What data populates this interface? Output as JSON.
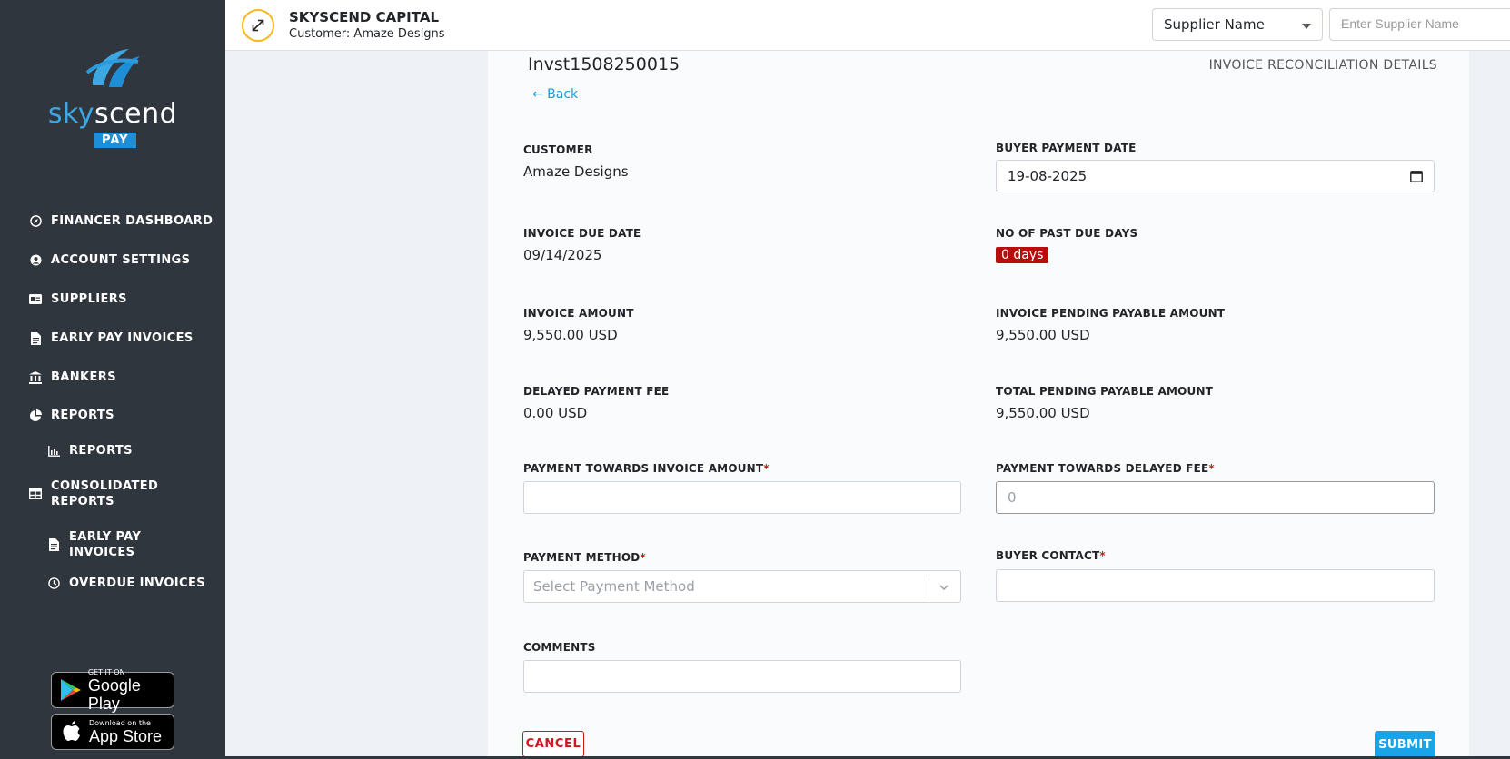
{
  "sidebar": {
    "logo": {
      "word_a": "sky",
      "word_b": "scend",
      "badge": "PAY"
    },
    "items": [
      {
        "label": "FINANCER DASHBOARD",
        "icon": "compass-icon"
      },
      {
        "label": "ACCOUNT SETTINGS",
        "icon": "user-circle-icon"
      },
      {
        "label": "SUPPLIERS",
        "icon": "id-card-icon"
      },
      {
        "label": "EARLY PAY INVOICES",
        "icon": "document-icon"
      },
      {
        "label": "BANKERS",
        "icon": "bank-icon"
      },
      {
        "label": "REPORTS",
        "icon": "pie-chart-icon"
      },
      {
        "label": "REPORTS",
        "icon": "bar-chart-icon"
      },
      {
        "label": "CONSOLIDATED REPORTS",
        "icon": "table-icon"
      },
      {
        "label": "EARLY PAY INVOICES",
        "icon": "document-icon"
      },
      {
        "label": "OVERDUE INVOICES",
        "icon": "clock-icon"
      }
    ],
    "stores": {
      "google_small": "GET IT ON",
      "google_big": "Google Play",
      "apple_small": "Download on the",
      "apple_big": "App Store"
    }
  },
  "header": {
    "company": "SKYSCEND CAPITAL",
    "customer_line": "Customer: Amaze Designs",
    "filter_select": "Supplier Name",
    "filter_placeholder": "Enter Supplier Name"
  },
  "page": {
    "invoice_id": "Invst1508250015",
    "back": "← Back",
    "title": "INVOICE RECONCILIATION DETAILS"
  },
  "details": {
    "customer_label": "CUSTOMER",
    "customer": "Amaze Designs",
    "buyer_payment_date_label": "BUYER PAYMENT DATE",
    "buyer_payment_date": "19-08-2025",
    "due_date_label": "INVOICE DUE DATE",
    "due_date": "09/14/2025",
    "past_due_label": "NO OF PAST DUE DAYS",
    "past_due": "0 days",
    "invoice_amount_label": "INVOICE AMOUNT",
    "invoice_amount": "9,550.00 USD",
    "pending_payable_label": "INVOICE PENDING PAYABLE AMOUNT",
    "pending_payable": "9,550.00 USD",
    "delayed_fee_label": "DELAYED PAYMENT FEE",
    "delayed_fee": "0.00 USD",
    "total_pending_label": "TOTAL PENDING PAYABLE AMOUNT",
    "total_pending": "9,550.00 USD"
  },
  "form": {
    "payment_invoice_label": "PAYMENT TOWARDS INVOICE AMOUNT",
    "payment_invoice_value": "",
    "payment_fee_label": "PAYMENT TOWARDS DELAYED FEE",
    "payment_fee_placeholder": "0",
    "method_label": "PAYMENT METHOD",
    "method_placeholder": "Select Payment Method",
    "buyer_contact_label": "BUYER CONTACT",
    "buyer_contact_value": "",
    "comments_label": "COMMENTS",
    "comments_value": "",
    "required_mark": "*",
    "cancel": "CANCEL",
    "submit": "SUBMIT"
  },
  "colors": {
    "sidebar": "#30363e",
    "accent": "#1aa4e8",
    "danger": "#d0161f",
    "badge": "#b80d0d"
  }
}
